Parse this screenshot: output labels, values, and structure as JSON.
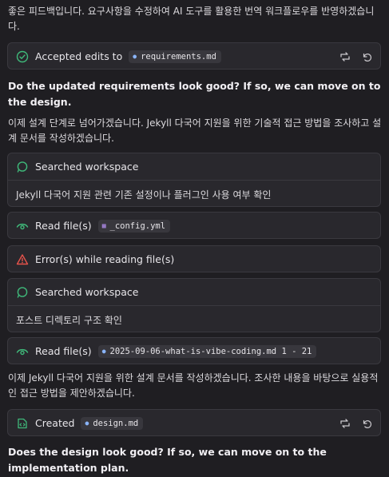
{
  "intro": {
    "text": "좋은 피드백입니다. 요구사항을 수정하여 AI 도구를 활용한 번역 워크플로우를 반영하겠습니다."
  },
  "accepted": {
    "label": "Accepted edits to",
    "file": "requirements.md"
  },
  "question1": "Do the updated requirements look good? If so, we can move on to the design.",
  "design_intro": "이제 설계 단계로 넘어가겠습니다. Jekyll 다국어 지원을 위한 기술적 접근 방법을 조사하고 설계 문서를 작성하겠습니다.",
  "search1": {
    "label": "Searched workspace",
    "detail": "Jekyll 다국어 지원 관련 기존 설정이나 플러그인 사용 여부 확인"
  },
  "read1": {
    "label": "Read file(s)",
    "file": "_config.yml"
  },
  "error1": {
    "label": "Error(s) while reading file(s)"
  },
  "search2": {
    "label": "Searched workspace",
    "detail": "포스트 디렉토리 구조 확인"
  },
  "read2": {
    "label": "Read file(s)",
    "file": "2025-09-06-what-is-vibe-coding.md 1 - 21"
  },
  "design_write": "이제 Jekyll 다국어 지원을 위한 설계 문서를 작성하겠습니다. 조사한 내용을 바탕으로 실용적인 접근 방법을 제안하겠습니다.",
  "created": {
    "label": "Created",
    "file": "design.md"
  },
  "question2": "Does the design look good? If so, we can move on to the implementation plan.",
  "colors": {
    "success": "#3fb97a",
    "error": "#e5534b",
    "accent": "#8ab4f8"
  }
}
